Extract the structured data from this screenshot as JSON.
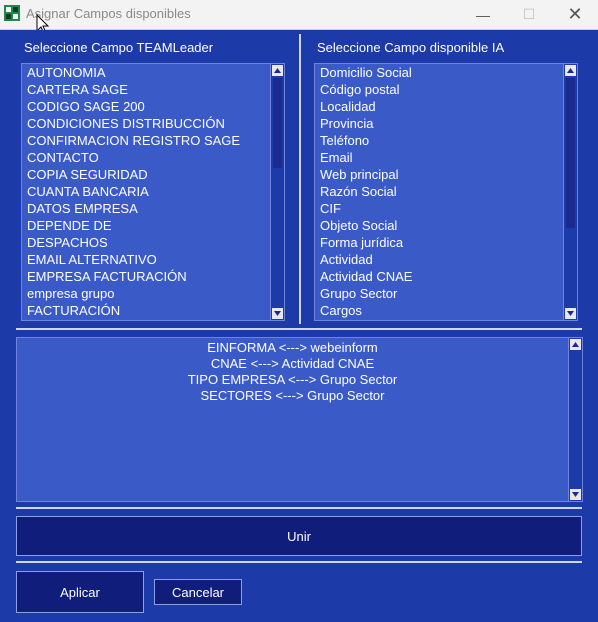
{
  "window": {
    "title": "Asignar Campos disponibles"
  },
  "left_panel": {
    "label": "Seleccione Campo TEAMLeader",
    "items": [
      "AUTONOMIA",
      "CARTERA SAGE",
      "CODIGO SAGE 200",
      "CONDICIONES DISTRIBUCCIÓN",
      "CONFIRMACION REGISTRO SAGE",
      "CONTACTO",
      "COPIA SEGURIDAD",
      "CUANTA BANCARIA",
      "DATOS EMPRESA",
      "DEPENDE DE",
      "DESPACHOS",
      "EMAIL ALTERNATIVO",
      "EMPRESA FACTURACIÓN",
      "empresa grupo",
      "FACTURACIÓN"
    ]
  },
  "right_panel": {
    "label": "Seleccione Campo disponible IA",
    "items": [
      "Domicilio Social",
      "Código postal",
      "Localidad",
      "Provincia",
      "Teléfono",
      "Email",
      "Web principal",
      "Razón Social",
      "CIF",
      "Objeto Social",
      "Forma jurídica",
      "Actividad",
      "Actividad CNAE",
      "Grupo Sector",
      "Cargos"
    ]
  },
  "mappings": [
    "EINFORMA <---> webeinform",
    "CNAE <---> Actividad CNAE",
    "TIPO EMPRESA <---> Grupo Sector",
    "SECTORES <---> Grupo Sector"
  ],
  "buttons": {
    "unir": "Unir",
    "aplicar": "Aplicar",
    "cancelar": "Cancelar"
  },
  "colors": {
    "background": "#1c3aa8",
    "list_background": "#3a5ac8",
    "button_background": "#101d7a"
  }
}
